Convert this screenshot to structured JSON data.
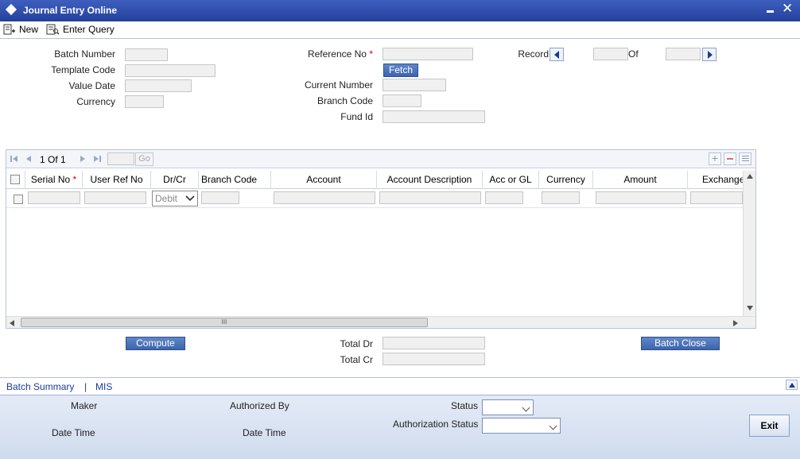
{
  "window": {
    "title": "Journal Entry Online"
  },
  "toolbar": {
    "new_label": "New",
    "enter_query_label": "Enter Query"
  },
  "form": {
    "batch_number_label": "Batch Number",
    "template_code_label": "Template Code",
    "value_date_label": "Value Date",
    "currency_label": "Currency",
    "reference_no_label": "Reference No",
    "required_mark": "*",
    "fetch_label": "Fetch",
    "current_number_label": "Current Number",
    "branch_code_label": "Branch Code",
    "fund_id_label": "Fund Id",
    "record_label": "Record",
    "of_label": "Of"
  },
  "grid": {
    "pager_text": "1 Of 1",
    "go_label": "Go",
    "columns": [
      "Serial No",
      "User Ref No",
      "Dr/Cr",
      "Branch Code",
      "Account",
      "Account Description",
      "Acc or GL",
      "Currency",
      "Amount",
      "Exchange"
    ],
    "row": {
      "dr_cr_value": "Debit"
    },
    "hscroll_grip": "III"
  },
  "totals": {
    "compute_label": "Compute",
    "total_dr_label": "Total Dr",
    "total_cr_label": "Total Cr",
    "batch_close_label": "Batch Close"
  },
  "links": {
    "batch_summary": "Batch Summary",
    "separator": "|",
    "mis": "MIS"
  },
  "footer": {
    "maker_label": "Maker",
    "date_time_label": "Date Time",
    "authorized_by_label": "Authorized By",
    "date_time_label_2": "Date Time",
    "status_label": "Status",
    "authorization_status_label": "Authorization Status",
    "exit_label": "Exit"
  },
  "colors": {
    "title_bar": "#2b4aa8",
    "button_blue": "#4a72b8",
    "footer_bg": "#d8e2f2",
    "required": "#dd0000"
  }
}
